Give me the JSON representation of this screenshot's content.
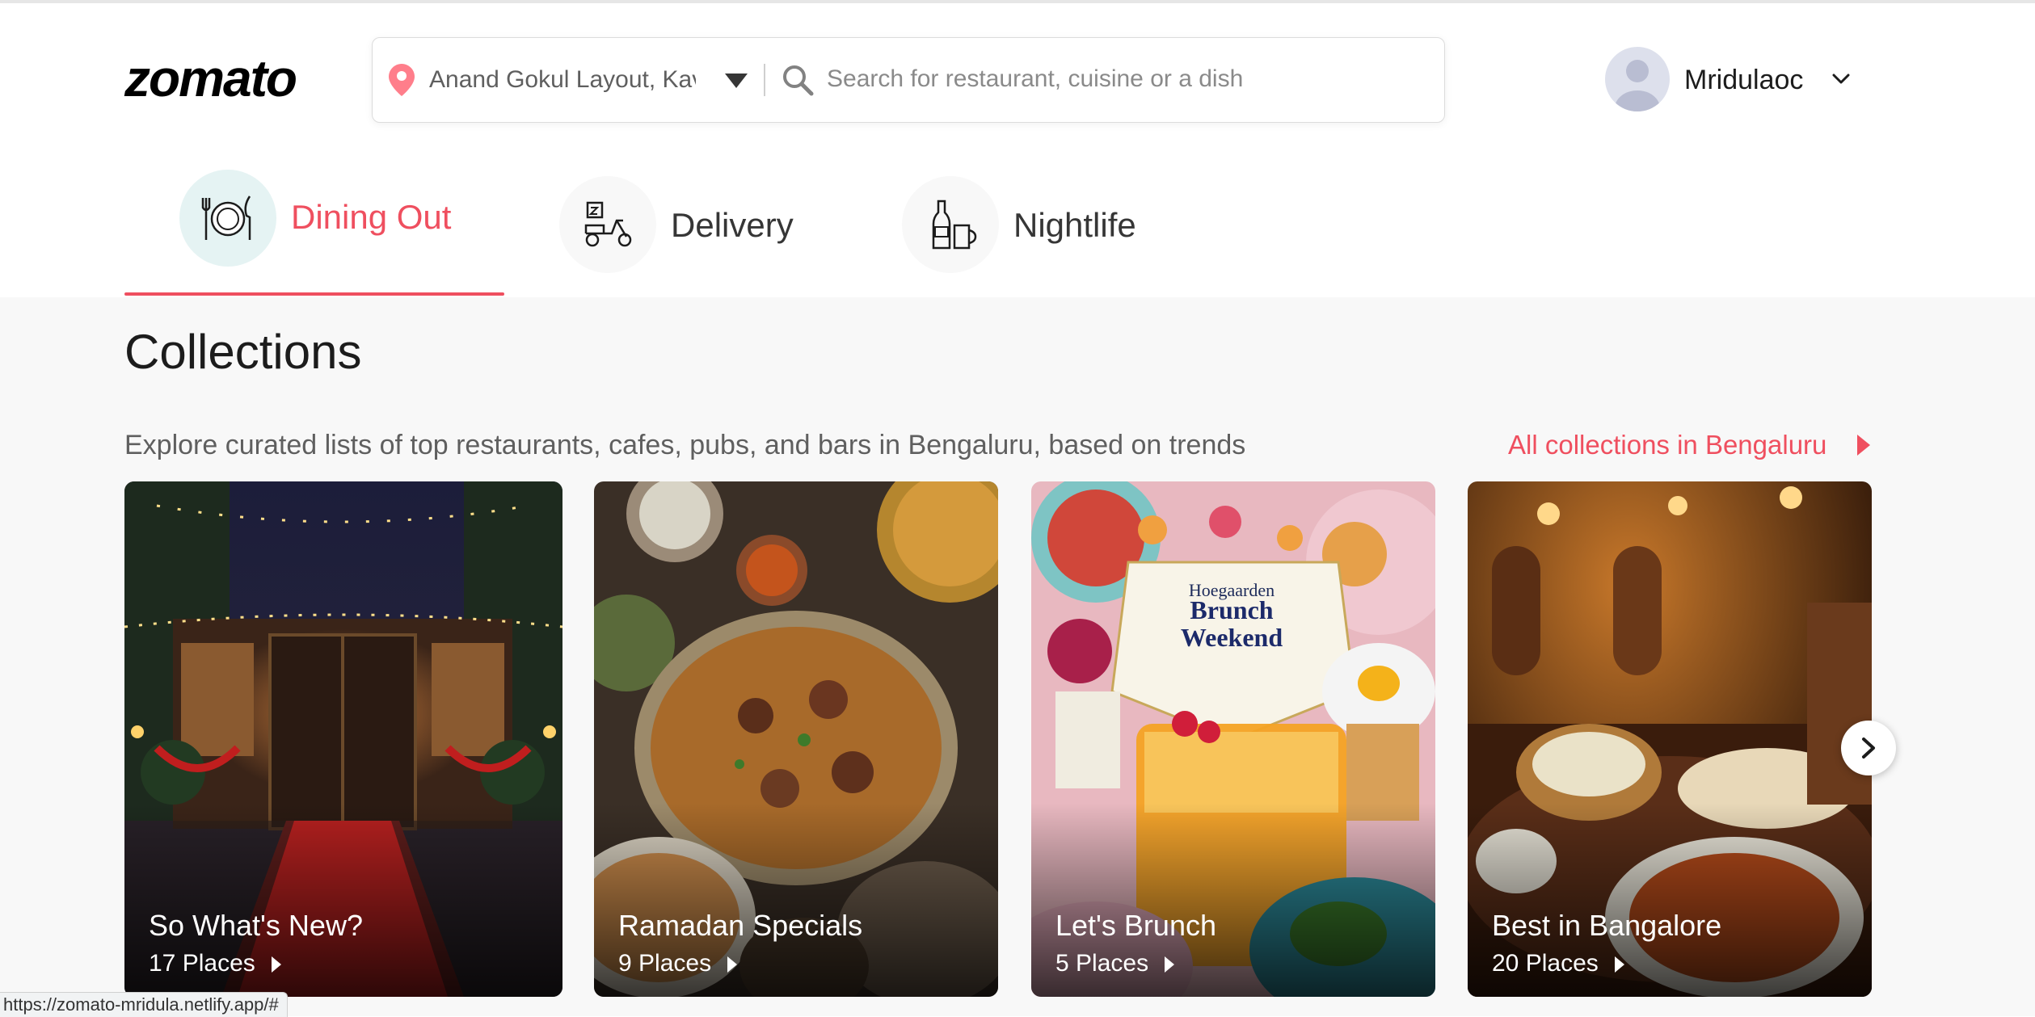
{
  "brand": {
    "logo_text": "zomato",
    "accent_color": "#ef4f5f"
  },
  "search": {
    "location_value": "Anand Gokul Layout, Kav",
    "placeholder": "Search for restaurant, cuisine or a dish",
    "icons": [
      "location-pin-icon",
      "caret-down-icon",
      "search-icon"
    ]
  },
  "user": {
    "name": "Mridulaoc"
  },
  "tabs": [
    {
      "label": "Dining Out",
      "icon": "dining-icon",
      "active": true
    },
    {
      "label": "Delivery",
      "icon": "scooter-icon",
      "active": false
    },
    {
      "label": "Nightlife",
      "icon": "bottles-icon",
      "active": false
    }
  ],
  "collections": {
    "title": "Collections",
    "subtitle": "Explore curated lists of top restaurants, cafes, pubs, and bars in Bengaluru, based on trends",
    "all_link": "All collections in Bengaluru",
    "cards": [
      {
        "title": "So What's New?",
        "count": "17 Places"
      },
      {
        "title": "Ramadan Specials",
        "count": "9 Places"
      },
      {
        "title": "Let's Brunch",
        "count": "5 Places",
        "image_text": [
          "Hoegaarden",
          "Brunch",
          "Weekend"
        ]
      },
      {
        "title": "Best in Bangalore",
        "count": "20 Places"
      }
    ]
  },
  "status_bar": {
    "url": "https://zomato-mridula.netlify.app/#"
  }
}
